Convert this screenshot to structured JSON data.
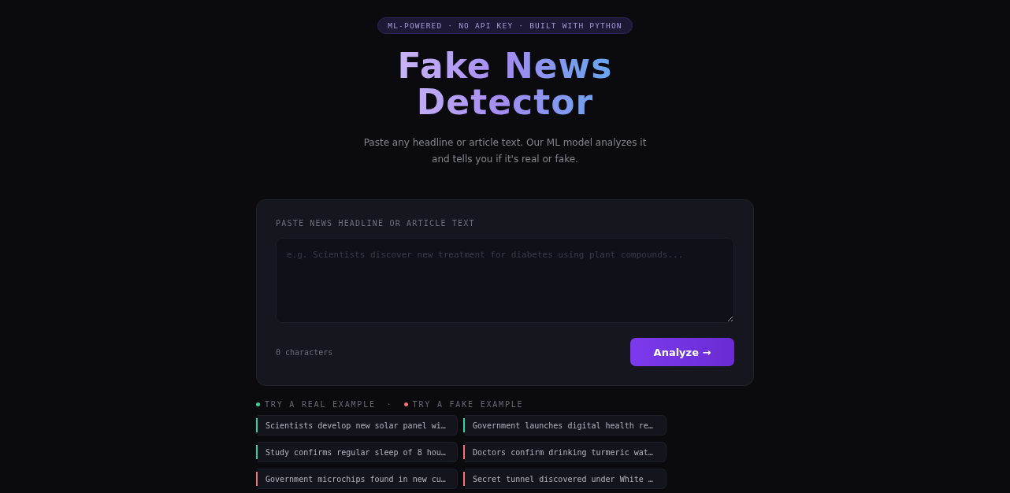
{
  "badge": "ML-POWERED · NO API KEY · BUILT WITH PYTHON",
  "title": [
    "Fake News",
    "Detector"
  ],
  "subtitle": "Paste any headline or article text. Our ML model analyzes it and tells you if it's real or fake.",
  "input": {
    "label": "PASTE NEWS HEADLINE OR ARTICLE TEXT",
    "placeholder": "e.g. Scientists discover new treatment for diabetes using plant compounds...",
    "count": "0 characters",
    "button": "Analyze →"
  },
  "legend": [
    {
      "label": "TRY A REAL EXAMPLE",
      "color": "#34d399"
    },
    {
      "label": "TRY A FAKE EXAMPLE",
      "color": "#f87171"
    }
  ],
  "legend_separator": "·",
  "examples": [
    {
      "text": "Scientists develop new solar panel wi…",
      "color": "#34d399"
    },
    {
      "text": "Government launches digital health re…",
      "color": "#34d399"
    },
    {
      "text": "Study confirms regular sleep of 8 hou…",
      "color": "#34d399"
    },
    {
      "text": "Doctors confirm drinking turmeric wat…",
      "color": "#f87171"
    },
    {
      "text": "Government microchips found in new cu…",
      "color": "#f87171"
    },
    {
      "text": "Secret tunnel discovered under White …",
      "color": "#f87171"
    }
  ]
}
